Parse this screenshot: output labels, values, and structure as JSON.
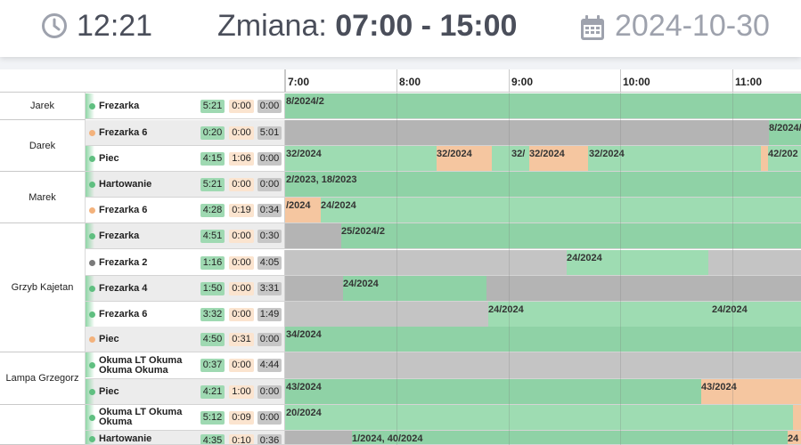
{
  "header": {
    "time": "12:21",
    "shift_label": "Zmiana: ",
    "shift_range": "07:00 - 15:00",
    "date": "2024-10-30",
    "clock_icon": "clock-icon",
    "calendar_icon": "calendar-icon"
  },
  "timeline": {
    "ticks": [
      "7:00",
      "8:00",
      "9:00",
      "10:00",
      "11:00"
    ]
  },
  "operators": [
    {
      "name": "Jarek"
    },
    {
      "name": "Darek"
    },
    {
      "name": "Marek"
    },
    {
      "name": "Grzyb Kajetan"
    },
    {
      "name": "Lampa Grzegorz"
    },
    {
      "name": ""
    }
  ],
  "rows": [
    {
      "machine": "Frezarka",
      "status": "green",
      "run": "5:21",
      "setup": "0:00",
      "idle": "0:00",
      "labels": [
        "8/2024/2"
      ]
    },
    {
      "machine": "Frezarka 6",
      "status": "orange",
      "run": "0:20",
      "setup": "0:00",
      "idle": "5:01",
      "labels": [
        "8/2024/"
      ]
    },
    {
      "machine": "Piec",
      "status": "green",
      "run": "4:15",
      "setup": "1:06",
      "idle": "0:00",
      "labels": [
        "32/2024",
        "32/2024",
        "32/",
        "32/2024",
        "32/2024",
        "42/202"
      ]
    },
    {
      "machine": "Hartowanie",
      "status": "green",
      "run": "5:21",
      "setup": "0:00",
      "idle": "0:00",
      "labels": [
        "2/2023, 18/2023"
      ]
    },
    {
      "machine": "Frezarka 6",
      "status": "orange",
      "run": "4:28",
      "setup": "0:19",
      "idle": "0:34",
      "labels": [
        "/2024",
        "24/2024"
      ]
    },
    {
      "machine": "Frezarka",
      "status": "green",
      "run": "4:51",
      "setup": "0:00",
      "idle": "0:30",
      "labels": [
        "25/2024/2"
      ]
    },
    {
      "machine": "Frezarka 2",
      "status": "grey",
      "run": "1:16",
      "setup": "0:00",
      "idle": "4:05",
      "labels": [
        "24/2024"
      ]
    },
    {
      "machine": "Frezarka 4",
      "status": "green",
      "run": "1:50",
      "setup": "0:00",
      "idle": "3:31",
      "labels": [
        "24/2024"
      ]
    },
    {
      "machine": "Frezarka 6",
      "status": "green",
      "run": "3:32",
      "setup": "0:00",
      "idle": "1:49",
      "labels": [
        "24/2024",
        "24/2024"
      ]
    },
    {
      "machine": "Piec",
      "status": "orange",
      "run": "4:50",
      "setup": "0:31",
      "idle": "0:00",
      "labels": [
        "34/2024"
      ]
    },
    {
      "machine": "Okuma LT Okuma Okuma Okuma",
      "status": "green",
      "run": "0:37",
      "setup": "0:00",
      "idle": "4:44",
      "labels": []
    },
    {
      "machine": "Piec",
      "status": "green",
      "run": "4:21",
      "setup": "1:00",
      "idle": "0:00",
      "labels": [
        "43/2024",
        "43/2024"
      ]
    },
    {
      "machine": "Okuma LT Okuma Okuma",
      "status": "green",
      "run": "5:12",
      "setup": "0:09",
      "idle": "0:00",
      "labels": [
        "20/2024"
      ]
    },
    {
      "machine": "Hartowanie",
      "status": "green",
      "run": "4:35",
      "setup": "0:10",
      "idle": "0:36",
      "labels": [
        "1/2024, 40/2024",
        "24"
      ]
    }
  ],
  "colors": {
    "run": "#9fd9b2",
    "setup": "#fbe4cf",
    "idle": "#c6c6c6",
    "orange": "#f5c6a0",
    "status_green": "#5fbf80",
    "status_orange": "#f3b27c",
    "status_grey": "#7a7a7a"
  }
}
